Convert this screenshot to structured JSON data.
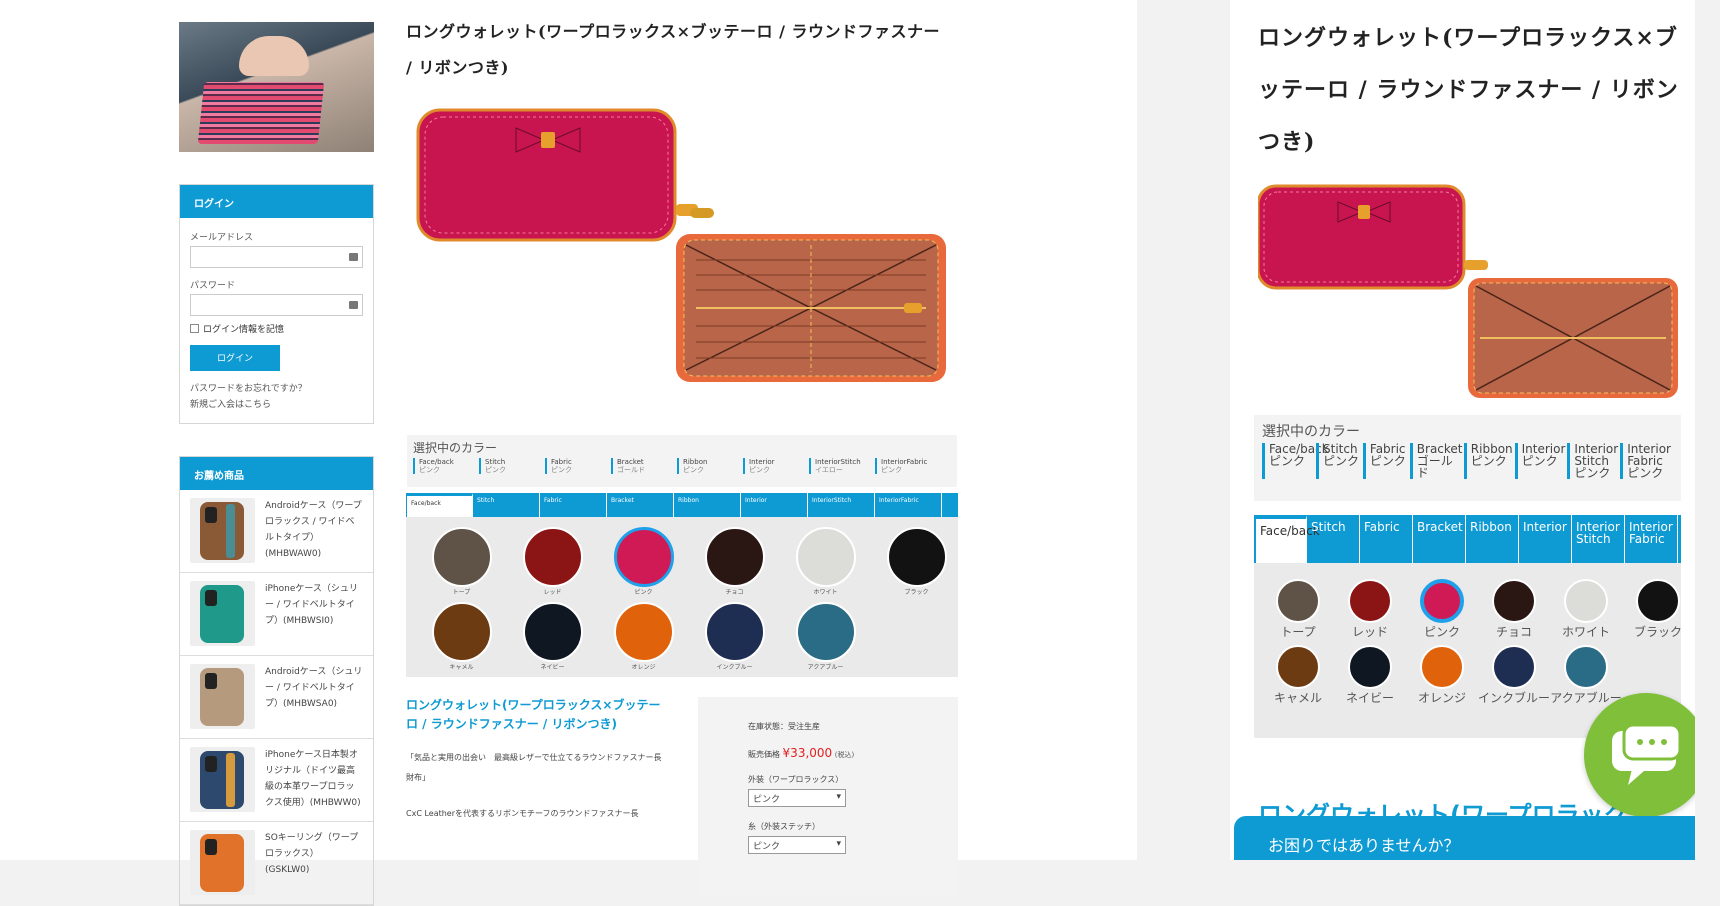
{
  "sidebar": {
    "login": {
      "heading": "ログイン",
      "email_label": "メールアドレス",
      "password_label": "パスワード",
      "remember_label": "ログイン情報を記憶",
      "button": "ログイン",
      "forgot_link": "パスワードをお忘れですか？",
      "register_link": "新規ご入会はこちら"
    },
    "recommend": {
      "heading": "お薦め商品",
      "items": [
        {
          "text": "Androidケース（ワープロラックス / ワイドベルトタイプ）(MHBWAW0)",
          "color": "#8a5a36",
          "strap": "#4a8d94"
        },
        {
          "text": "iPhoneケース（シュリー / ワイドベルトタイプ）(MHBWSI0)",
          "color": "#1f9a8a",
          "strap": "#1f9a8a"
        },
        {
          "text": "Androidケース（シュリー / ワイドベルトタイプ）(MHBWSA0)",
          "color": "#b59a7e",
          "strap": "#b59a7e"
        },
        {
          "text": "iPhoneケース日本製オリジナル（ドイツ最高級の本革ワープロラックス使用）(MHBWW0)",
          "color": "#2d4a6e",
          "strap": "#d79b3f"
        },
        {
          "text": "SOキーリング（ワープロラックス）(GSKLW0)",
          "color": "#e0722a",
          "strap": "#e0722a"
        }
      ]
    }
  },
  "product": {
    "title": "ロングウォレット(ワープロラックス×ブッテーロ / ラウンドファスナー / リボンつき)",
    "selected_heading": "選択中のカラー",
    "selected": [
      {
        "part": "Face/back",
        "value": "ピンク"
      },
      {
        "part": "Stitch",
        "value": "ピンク"
      },
      {
        "part": "Fabric",
        "value": "ピンク"
      },
      {
        "part": "Bracket",
        "value": "ゴールド"
      },
      {
        "part": "Ribbon",
        "value": "ピンク"
      },
      {
        "part": "Interior",
        "value": "ピンク"
      },
      {
        "part": "InteriorStitch",
        "value": "イエロー"
      },
      {
        "part": "InteriorFabric",
        "value": "ピンク"
      }
    ],
    "tabs": [
      "Face/back",
      "Stitch",
      "Fabric",
      "Bracket",
      "Ribbon",
      "Interior",
      "InteriorStitch",
      "InteriorFabric"
    ],
    "swatches": [
      {
        "name": "トープ",
        "color": "#5f5246"
      },
      {
        "name": "レッド",
        "color": "#8b1515"
      },
      {
        "name": "ピンク",
        "color": "#d01a55",
        "active": true
      },
      {
        "name": "チョコ",
        "color": "#2a1613"
      },
      {
        "name": "ホワイト",
        "color": "#dcdcd8"
      },
      {
        "name": "ブラック",
        "color": "#121212"
      },
      {
        "name": "キャメル",
        "color": "#6c3b12"
      },
      {
        "name": "ネイビー",
        "color": "#0f1722"
      },
      {
        "name": "オレンジ",
        "color": "#e0620a"
      },
      {
        "name": "インクブルー",
        "color": "#1e2d52"
      },
      {
        "name": "アクアブルー",
        "color": "#2a6b86"
      }
    ],
    "description_title": "ロングウォレット(ワープロラックス×ブッテーロ / ラウンドファスナー / リボンつき)",
    "description_lead": "「気品と実用の出会い　最高級レザーで仕立てるラウンドファスナー長財布」",
    "description_text": "CxC Leatherを代表するリボンモチーフのラウンドファスナー長",
    "stock_status": "在庫状態：受注生産",
    "price_label": "販売価格",
    "price": "¥33,000",
    "tax": "(税込)",
    "option1_label": "外装（ワープロラックス）",
    "option1_value": "ピンク",
    "option2_label": "糸（外装ステッチ）",
    "option2_value": "ピンク"
  },
  "mobile": {
    "title": "ロングウォレット(ワープロラックス×ブッテーロ / ラウンドファスナー / リボンつき)",
    "selected_heading": "選択中のカラー",
    "selected": [
      {
        "part": "Face/back",
        "value": "ピンク"
      },
      {
        "part": "Stitch",
        "value": "ピンク"
      },
      {
        "part": "Fabric",
        "value": "ピンク"
      },
      {
        "part": "Bracket",
        "value": "ゴールド"
      },
      {
        "part": "Ribbon",
        "value": "ピンク"
      },
      {
        "part": "Interior",
        "value": "ピンク"
      },
      {
        "part": "Interior Stitch",
        "value": "ピンク"
      },
      {
        "part": "Interior Fabric",
        "value": "ピンク"
      }
    ],
    "tabs": [
      "Face/back",
      "Stitch",
      "Fabric",
      "Bracket",
      "Ribbon",
      "Interior",
      "Interior Stitch",
      "Interior Fabric"
    ],
    "description_title": "ロングウォレット(ワープロラック",
    "chat_label": "お困りではありませんか？"
  }
}
